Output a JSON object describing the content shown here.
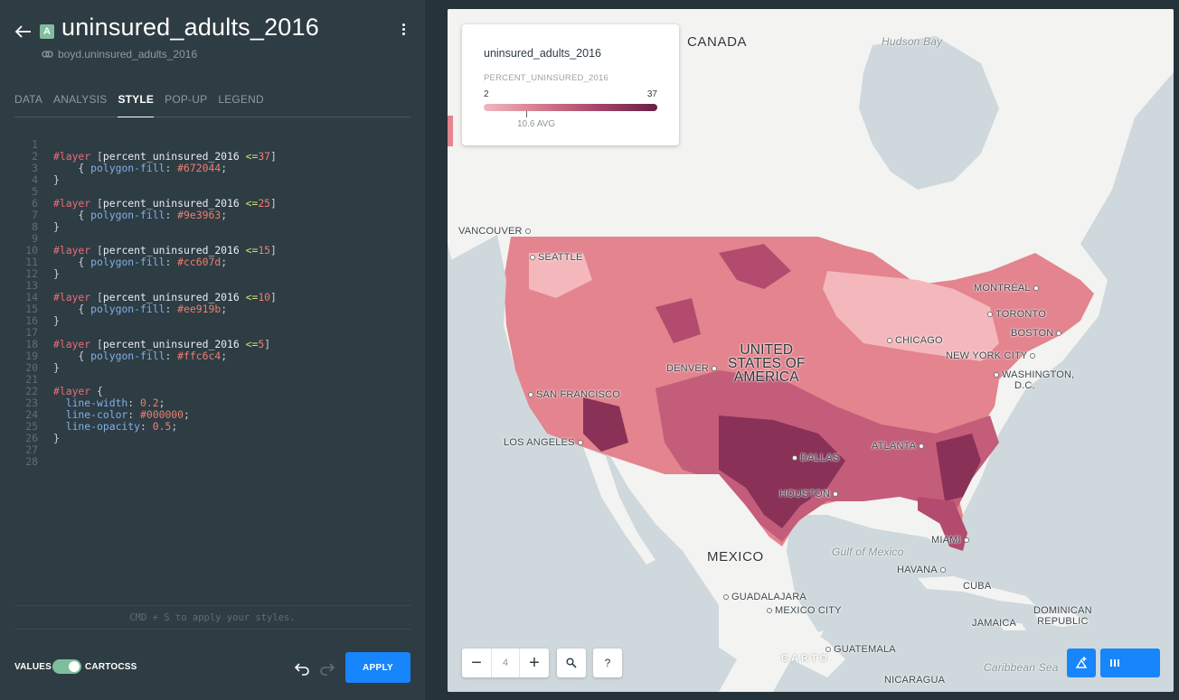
{
  "header": {
    "badge": "A",
    "title": "uninsured_adults_2016",
    "source": "boyd.uninsured_adults_2016"
  },
  "tabs": [
    {
      "label": "DATA"
    },
    {
      "label": "ANALYSIS"
    },
    {
      "label": "STYLE"
    },
    {
      "label": "POP-UP"
    },
    {
      "label": "LEGEND"
    }
  ],
  "active_tab": "STYLE",
  "editor": {
    "lines": [
      [],
      [
        [
          "sel",
          "#layer"
        ],
        [
          "br",
          " ["
        ],
        [
          "attr",
          "percent_uninsured_2016 "
        ],
        [
          "op",
          "<="
        ],
        [
          "num",
          "37"
        ],
        [
          "br",
          "]"
        ]
      ],
      [
        [
          "br",
          "    { "
        ],
        [
          "prop",
          "polygon-fill"
        ],
        [
          "br",
          ": "
        ],
        [
          "col",
          "#672044"
        ],
        [
          "br",
          ";"
        ]
      ],
      [
        [
          "br",
          "}"
        ]
      ],
      [],
      [
        [
          "sel",
          "#layer"
        ],
        [
          "br",
          " ["
        ],
        [
          "attr",
          "percent_uninsured_2016 "
        ],
        [
          "op",
          "<="
        ],
        [
          "num",
          "25"
        ],
        [
          "br",
          "]"
        ]
      ],
      [
        [
          "br",
          "    { "
        ],
        [
          "prop",
          "polygon-fill"
        ],
        [
          "br",
          ": "
        ],
        [
          "col",
          "#9e3963"
        ],
        [
          "br",
          ";"
        ]
      ],
      [
        [
          "br",
          "}"
        ]
      ],
      [],
      [
        [
          "sel",
          "#layer"
        ],
        [
          "br",
          " ["
        ],
        [
          "attr",
          "percent_uninsured_2016 "
        ],
        [
          "op",
          "<="
        ],
        [
          "num",
          "15"
        ],
        [
          "br",
          "]"
        ]
      ],
      [
        [
          "br",
          "    { "
        ],
        [
          "prop",
          "polygon-fill"
        ],
        [
          "br",
          ": "
        ],
        [
          "col",
          "#cc607d"
        ],
        [
          "br",
          ";"
        ]
      ],
      [
        [
          "br",
          "}"
        ]
      ],
      [],
      [
        [
          "sel",
          "#layer"
        ],
        [
          "br",
          " ["
        ],
        [
          "attr",
          "percent_uninsured_2016 "
        ],
        [
          "op",
          "<="
        ],
        [
          "num",
          "10"
        ],
        [
          "br",
          "]"
        ]
      ],
      [
        [
          "br",
          "    { "
        ],
        [
          "prop",
          "polygon-fill"
        ],
        [
          "br",
          ": "
        ],
        [
          "col",
          "#ee919b"
        ],
        [
          "br",
          ";"
        ]
      ],
      [
        [
          "br",
          "}"
        ]
      ],
      [],
      [
        [
          "sel",
          "#layer"
        ],
        [
          "br",
          " ["
        ],
        [
          "attr",
          "percent_uninsured_2016 "
        ],
        [
          "op",
          "<="
        ],
        [
          "num",
          "5"
        ],
        [
          "br",
          "]"
        ]
      ],
      [
        [
          "br",
          "    { "
        ],
        [
          "prop",
          "polygon-fill"
        ],
        [
          "br",
          ": "
        ],
        [
          "col",
          "#ffc6c4"
        ],
        [
          "br",
          ";"
        ]
      ],
      [
        [
          "br",
          "}"
        ]
      ],
      [],
      [
        [
          "sel",
          "#layer"
        ],
        [
          "br",
          " {"
        ]
      ],
      [
        [
          "prop",
          "  line-width"
        ],
        [
          "br",
          ": "
        ],
        [
          "num",
          "0.2"
        ],
        [
          "br",
          ";"
        ]
      ],
      [
        [
          "prop",
          "  line-color"
        ],
        [
          "br",
          ": "
        ],
        [
          "col",
          "#000000"
        ],
        [
          "br",
          ";"
        ]
      ],
      [
        [
          "prop",
          "  line-opacity"
        ],
        [
          "br",
          ": "
        ],
        [
          "num",
          "0.5"
        ],
        [
          "br",
          ";"
        ]
      ],
      [
        [
          "br",
          "}"
        ]
      ],
      [],
      []
    ],
    "hint": "CMD + S to apply your styles."
  },
  "footer": {
    "values_label": "VALUES",
    "cartocss_label": "CARTOCSS",
    "toggle_on": true,
    "apply_label": "APPLY"
  },
  "legend": {
    "title": "uninsured_adults_2016",
    "field": "PERCENT_UNINSURED_2016",
    "min": "2",
    "max": "37",
    "avg": "10.6 AVG",
    "colors": [
      "#ffc6c4",
      "#ee919b",
      "#cc607d",
      "#9e3963",
      "#672044"
    ]
  },
  "map": {
    "zoom": "4",
    "zoom_out": "−",
    "zoom_in": "+",
    "help": "?",
    "attribution": "CARTO",
    "labels": {
      "canada": "CANADA",
      "hudson_bay": "Hudson Bay",
      "usa_line1": "UNITED",
      "usa_line2": "STATES OF",
      "usa_line3": "AMERICA",
      "mexico": "MEXICO",
      "gulf": "Gulf of Mexico",
      "caribbean": "Caribbean Sea",
      "vancouver": "VANCOUVER",
      "seattle": "SEATTLE",
      "montreal": "MONTRÉAL",
      "toronto": "TORONTO",
      "boston": "BOSTON",
      "chicago": "CHICAGO",
      "new_york": "NEW YORK CITY",
      "washington1": "WASHINGTON,",
      "washington2": "D.C.",
      "denver": "DENVER",
      "san_francisco": "SAN FRANCISCO",
      "los_angeles": "LOS ANGELES",
      "dallas": "DALLAS",
      "atlanta": "ATLANTA",
      "houston": "HOUSTON",
      "miami": "MIAMI",
      "havana": "HAVANA",
      "cuba": "CUBA",
      "guadalajara": "GUADALAJARA",
      "mexico_city": "MEXICO CITY",
      "guatemala": "GUATEMALA",
      "jamaica": "JAMAICA",
      "dominican1": "DOMINICAN",
      "dominican2": "REPUBLIC",
      "nicaragua": "NICARAGUA"
    }
  }
}
